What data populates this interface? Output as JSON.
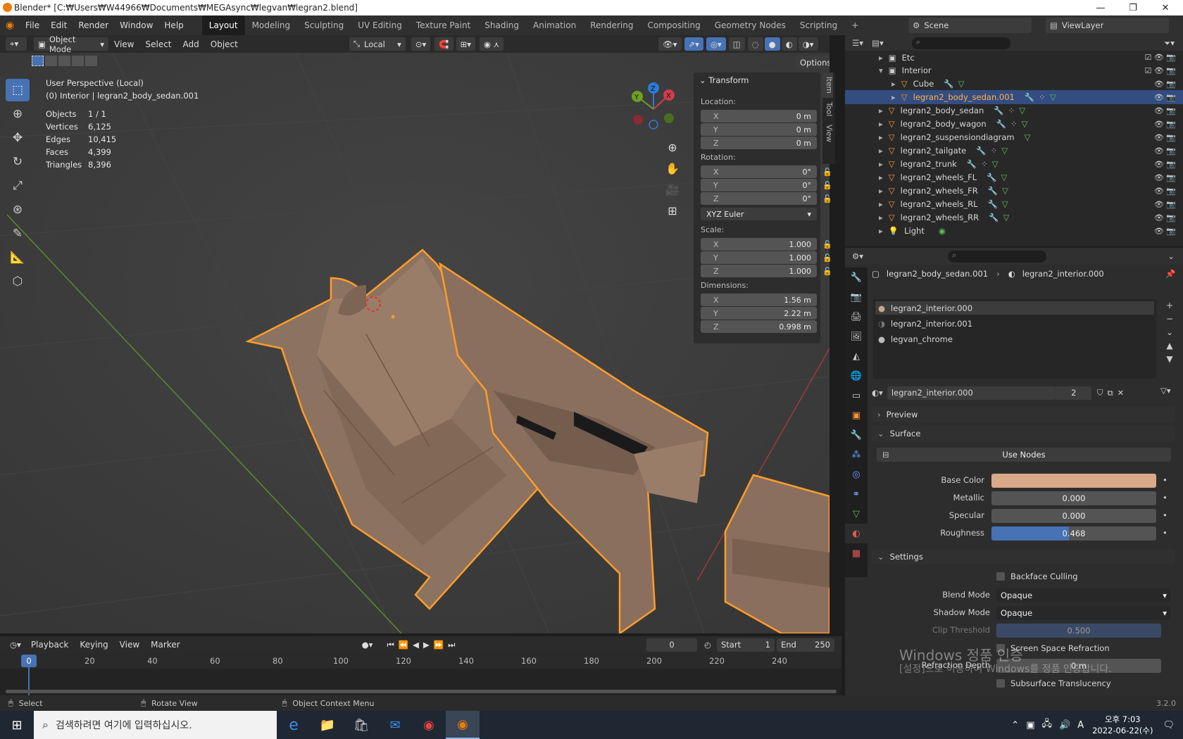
{
  "window": {
    "title": "Blender* [C:₩Users₩W44966₩Documents₩MEGAsync₩legvan₩legran2.blend]"
  },
  "menu": [
    "File",
    "Edit",
    "Render",
    "Window",
    "Help"
  ],
  "workspaces": [
    "Layout",
    "Modeling",
    "Sculpting",
    "UV Editing",
    "Texture Paint",
    "Shading",
    "Animation",
    "Rendering",
    "Compositing",
    "Geometry Nodes",
    "Scripting"
  ],
  "scene": {
    "scene_name": "Scene",
    "view_layer": "ViewLayer"
  },
  "viewport_header": {
    "mode": "Object Mode",
    "menus": [
      "View",
      "Select",
      "Add",
      "Object"
    ],
    "transform_orientation": "Local",
    "options_label": "Options"
  },
  "viewport_overlay": {
    "perspective": "User Perspective (Local)",
    "context": "(0) Interior | legran2_body_sedan.001",
    "stats": [
      {
        "label": "Objects",
        "value": "1 / 1"
      },
      {
        "label": "Vertices",
        "value": "6,125"
      },
      {
        "label": "Edges",
        "value": "10,415"
      },
      {
        "label": "Faces",
        "value": "4,399"
      },
      {
        "label": "Triangles",
        "value": "8,396"
      }
    ]
  },
  "gizmo": {
    "x": "X",
    "y": "Y",
    "z": "Z"
  },
  "npanel": {
    "title": "Transform",
    "location_label": "Location:",
    "location": [
      {
        "axis": "X",
        "value": "0 m"
      },
      {
        "axis": "Y",
        "value": "0 m"
      },
      {
        "axis": "Z",
        "value": "0 m"
      }
    ],
    "rotation_label": "Rotation:",
    "rotation": [
      {
        "axis": "X",
        "value": "0°"
      },
      {
        "axis": "Y",
        "value": "0°"
      },
      {
        "axis": "Z",
        "value": "0°"
      }
    ],
    "rotation_mode": "XYZ Euler",
    "scale_label": "Scale:",
    "scale": [
      {
        "axis": "X",
        "value": "1.000"
      },
      {
        "axis": "Y",
        "value": "1.000"
      },
      {
        "axis": "Z",
        "value": "1.000"
      }
    ],
    "dimensions_label": "Dimensions:",
    "dimensions": [
      {
        "axis": "X",
        "value": "1.56 m"
      },
      {
        "axis": "Y",
        "value": "2.22 m"
      },
      {
        "axis": "Z",
        "value": "0.998 m"
      }
    ],
    "tabs": [
      "Item",
      "Tool",
      "View"
    ]
  },
  "outliner": {
    "rows": [
      {
        "name": "Etc",
        "indent": 0,
        "type": "collection"
      },
      {
        "name": "Interior",
        "indent": 0,
        "type": "collection"
      },
      {
        "name": "Cube",
        "indent": 1,
        "type": "mesh"
      },
      {
        "name": "legran2_body_sedan.001",
        "indent": 1,
        "type": "mesh",
        "selected": true
      },
      {
        "name": "legran2_body_sedan",
        "indent": 0,
        "type": "mesh"
      },
      {
        "name": "legran2_body_wagon",
        "indent": 0,
        "type": "mesh"
      },
      {
        "name": "legran2_suspensiondiagram",
        "indent": 0,
        "type": "mesh"
      },
      {
        "name": "legran2_tailgate",
        "indent": 0,
        "type": "mesh"
      },
      {
        "name": "legran2_trunk",
        "indent": 0,
        "type": "mesh"
      },
      {
        "name": "legran2_wheels_FL",
        "indent": 0,
        "type": "mesh"
      },
      {
        "name": "legran2_wheels_FR",
        "indent": 0,
        "type": "mesh"
      },
      {
        "name": "legran2_wheels_RL",
        "indent": 0,
        "type": "mesh"
      },
      {
        "name": "legran2_wheels_RR",
        "indent": 0,
        "type": "mesh"
      },
      {
        "name": "Light",
        "indent": 0,
        "type": "light"
      }
    ]
  },
  "properties": {
    "breadcrumb_object": "legran2_body_sedan.001",
    "breadcrumb_material": "legran2_interior.000",
    "material_slots": [
      "legran2_interior.000",
      "legran2_interior.001",
      "legvan_chrome"
    ],
    "active_material": "legran2_interior.000",
    "users": "2",
    "preview_label": "Preview",
    "surface_label": "Surface",
    "use_nodes_label": "Use Nodes",
    "base_color_label": "Base Color",
    "base_color": "#d9a98a",
    "metallic_label": "Metallic",
    "metallic": "0.000",
    "specular_label": "Specular",
    "specular": "0.000",
    "roughness_label": "Roughness",
    "roughness": "0.468",
    "roughness_fraction": 0.468,
    "settings_label": "Settings",
    "backface_culling": "Backface Culling",
    "blend_mode_label": "Blend Mode",
    "blend_mode": "Opaque",
    "shadow_mode_label": "Shadow Mode",
    "shadow_mode": "Opaque",
    "clip_threshold_label": "Clip Threshold",
    "clip_threshold": "0.500",
    "ssr_label": "Screen Space Refraction",
    "refraction_depth_label": "Refraction Depth",
    "refraction_depth": "0 m",
    "subsurface_label": "Subsurface Translucency"
  },
  "timeline": {
    "menus": [
      "Playback",
      "Keying",
      "View",
      "Marker"
    ],
    "current_frame": "0",
    "start_label": "Start",
    "start": "1",
    "end_label": "End",
    "end": "250",
    "ticks": [
      "0",
      "20",
      "40",
      "60",
      "80",
      "100",
      "120",
      "140",
      "160",
      "180",
      "200",
      "220",
      "240"
    ]
  },
  "statusbar": {
    "select": "Select",
    "rotate": "Rotate View",
    "context_menu": "Object Context Menu",
    "version": "3.2.0"
  },
  "watermark": {
    "line1": "Windows 정품 인증",
    "line2": "[설정]으로 이동하여 Windows를 정품 인증합니다."
  },
  "taskbar": {
    "search_placeholder": "검색하려면 여기에 입력하십시오.",
    "time": "오후 7:03",
    "date": "2022-06-22(수)",
    "ime": "A"
  },
  "colors": {
    "accent": "#4772b3",
    "selection_outline": "#ff9c2a",
    "seat": "#8c7260"
  }
}
